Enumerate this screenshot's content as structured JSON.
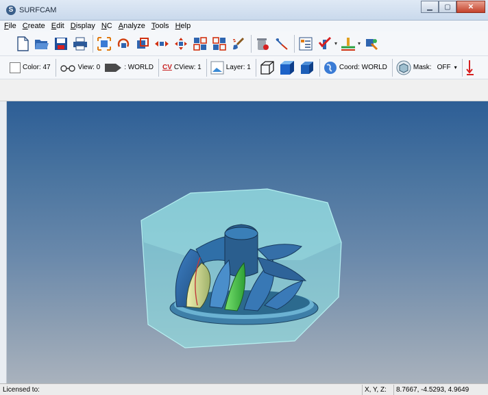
{
  "window": {
    "title": "SURFCAM"
  },
  "menu": {
    "items": [
      "File",
      "Create",
      "Edit",
      "Display",
      "NC",
      "Analyze",
      "Tools",
      "Help"
    ]
  },
  "toolbar2": {
    "color": "Color: 47",
    "view": "View: 0",
    "world": ": WORLD",
    "cview_icon": "CV",
    "cview": "CView: 1",
    "layer": "Layer: 1",
    "coord": "Coord: WORLD",
    "mask": "Mask:",
    "mask_value": "OFF"
  },
  "status": {
    "licensed": "Licensed to:",
    "coord_label": "X, Y, Z:",
    "coord_value": "8.7667, -4.5293, 4.9649"
  },
  "colors": {
    "accent": "#2d5e96",
    "stock": "#7ed6d6",
    "blade_green": "#4ec24e",
    "blade_yellow": "#d8e08a"
  }
}
